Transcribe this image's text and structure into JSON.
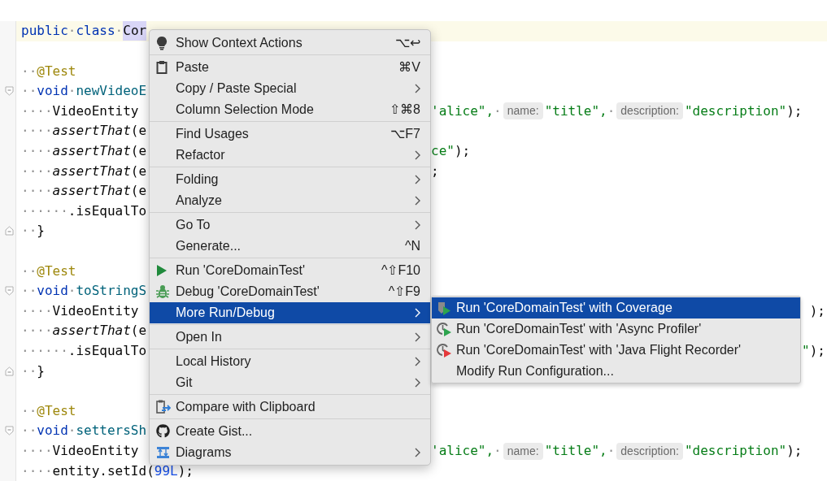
{
  "editor": {
    "lines": [
      {
        "current": true,
        "kind": "plain",
        "left": [
          {
            "kind": "keyword",
            "text": "public"
          },
          {
            "kind": "space",
            "text": "·"
          },
          {
            "kind": "keyword",
            "text": "class"
          },
          {
            "kind": "space",
            "text": "·"
          },
          {
            "kind": "selected",
            "text": "Cor"
          }
        ]
      },
      {
        "current": false,
        "kind": "plain"
      },
      {
        "current": false,
        "kind": "plain",
        "left": [
          {
            "kind": "space",
            "text": "··"
          },
          {
            "kind": "annotation",
            "text": "@Test"
          }
        ]
      },
      {
        "current": false,
        "kind": "foldstart",
        "left": [
          {
            "kind": "space",
            "text": "··"
          },
          {
            "kind": "keyword",
            "text": "void"
          },
          {
            "kind": "space",
            "text": "·"
          },
          {
            "kind": "method",
            "text": "newVideoE"
          }
        ]
      },
      {
        "current": false,
        "kind": "plain",
        "left": [
          {
            "kind": "space",
            "text": "····"
          },
          {
            "kind": "plain",
            "text": "VideoEntity"
          }
        ],
        "right": [
          {
            "kind": "string",
            "text": "'alice\","
          },
          {
            "kind": "space",
            "text": "·"
          },
          {
            "kind": "hint",
            "text": "name:"
          },
          {
            "kind": "string",
            "text": "\"title\","
          },
          {
            "kind": "space",
            "text": "·"
          },
          {
            "kind": "hint",
            "text": "description:"
          },
          {
            "kind": "string",
            "text": "\"description\""
          },
          {
            "kind": "plain",
            "text": ");"
          }
        ]
      },
      {
        "current": false,
        "kind": "plain",
        "left": [
          {
            "kind": "space",
            "text": "····"
          },
          {
            "kind": "italic",
            "text": "assertThat"
          },
          {
            "kind": "plain",
            "text": "(e"
          }
        ]
      },
      {
        "current": false,
        "kind": "plain",
        "left": [
          {
            "kind": "space",
            "text": "····"
          },
          {
            "kind": "italic",
            "text": "assertThat"
          },
          {
            "kind": "plain",
            "text": "(e"
          }
        ],
        "right": [
          {
            "kind": "string",
            "text": "ce\""
          },
          {
            "kind": "plain",
            "text": ");"
          }
        ]
      },
      {
        "current": false,
        "kind": "plain",
        "left": [
          {
            "kind": "space",
            "text": "····"
          },
          {
            "kind": "italic",
            "text": "assertThat"
          },
          {
            "kind": "plain",
            "text": "(e"
          }
        ],
        "right": [
          {
            "kind": "plain",
            "text": ";"
          }
        ]
      },
      {
        "current": false,
        "kind": "plain",
        "left": [
          {
            "kind": "space",
            "text": "····"
          },
          {
            "kind": "italic",
            "text": "assertThat"
          },
          {
            "kind": "plain",
            "text": "(e"
          }
        ]
      },
      {
        "current": false,
        "kind": "plain",
        "left": [
          {
            "kind": "space",
            "text": "······"
          },
          {
            "kind": "plain",
            "text": ".isEqualTo"
          }
        ]
      },
      {
        "current": false,
        "kind": "foldend",
        "left": [
          {
            "kind": "space",
            "text": "··"
          },
          {
            "kind": "plain",
            "text": "}"
          }
        ]
      },
      {
        "current": false,
        "kind": "plain"
      },
      {
        "current": false,
        "kind": "plain",
        "left": [
          {
            "kind": "space",
            "text": "··"
          },
          {
            "kind": "annotation",
            "text": "@Test"
          }
        ]
      },
      {
        "current": false,
        "kind": "foldstart",
        "left": [
          {
            "kind": "space",
            "text": "··"
          },
          {
            "kind": "keyword",
            "text": "void"
          },
          {
            "kind": "space",
            "text": "·"
          },
          {
            "kind": "method",
            "text": "toStringS"
          }
        ]
      },
      {
        "current": false,
        "kind": "trailing",
        "left": [
          {
            "kind": "space",
            "text": "····"
          },
          {
            "kind": "plain",
            "text": "VideoEntity"
          }
        ],
        "right": [
          {
            "kind": "plain",
            "text": ");"
          }
        ]
      },
      {
        "current": false,
        "kind": "plain",
        "left": [
          {
            "kind": "space",
            "text": "····"
          },
          {
            "kind": "italic",
            "text": "assertThat"
          },
          {
            "kind": "plain",
            "text": "(e"
          }
        ]
      },
      {
        "current": false,
        "kind": "trailing",
        "left": [
          {
            "kind": "space",
            "text": "······"
          },
          {
            "kind": "plain",
            "text": ".isEqualTo"
          }
        ],
        "right": [
          {
            "kind": "string",
            "text": "\""
          },
          {
            "kind": "plain",
            "text": ");"
          }
        ]
      },
      {
        "current": false,
        "kind": "foldend",
        "left": [
          {
            "kind": "space",
            "text": "··"
          },
          {
            "kind": "plain",
            "text": "}"
          }
        ]
      },
      {
        "current": false,
        "kind": "plain"
      },
      {
        "current": false,
        "kind": "plain",
        "left": [
          {
            "kind": "space",
            "text": "··"
          },
          {
            "kind": "annotation",
            "text": "@Test"
          }
        ]
      },
      {
        "current": false,
        "kind": "foldstart",
        "left": [
          {
            "kind": "space",
            "text": "··"
          },
          {
            "kind": "keyword",
            "text": "void"
          },
          {
            "kind": "space",
            "text": "·"
          },
          {
            "kind": "method",
            "text": "settersSh"
          }
        ]
      },
      {
        "current": false,
        "kind": "plain",
        "left": [
          {
            "kind": "space",
            "text": "····"
          },
          {
            "kind": "plain",
            "text": "VideoEntity"
          }
        ],
        "right": [
          {
            "kind": "string",
            "text": "'alice\","
          },
          {
            "kind": "space",
            "text": "·"
          },
          {
            "kind": "hint",
            "text": "name:"
          },
          {
            "kind": "string",
            "text": "\"title\","
          },
          {
            "kind": "space",
            "text": "·"
          },
          {
            "kind": "hint",
            "text": "description:"
          },
          {
            "kind": "string",
            "text": "\"description\""
          },
          {
            "kind": "plain",
            "text": ");"
          }
        ]
      },
      {
        "current": false,
        "kind": "plain",
        "left": [
          {
            "kind": "space",
            "text": "····"
          },
          {
            "kind": "plain",
            "text": "entity.setId("
          },
          {
            "kind": "number",
            "text": "99L"
          },
          {
            "kind": "plain",
            "text": ");"
          }
        ]
      }
    ]
  },
  "context_menu": {
    "groups": [
      {
        "items": [
          {
            "kind": "bulb",
            "label": "Show Context Actions",
            "shortcut": "⌥↩",
            "submenu": false,
            "selected": false
          }
        ]
      },
      {
        "items": [
          {
            "kind": "clipboard",
            "label": "Paste",
            "shortcut": "⌘V",
            "submenu": false,
            "selected": false
          },
          {
            "kind": "text",
            "label": "Copy / Paste Special",
            "submenu": true,
            "selected": false
          },
          {
            "kind": "text",
            "label": "Column Selection Mode",
            "shortcut": "⇧⌘8",
            "submenu": false,
            "selected": false
          }
        ]
      },
      {
        "items": [
          {
            "kind": "text",
            "label": "Find Usages",
            "shortcut": "⌥F7",
            "submenu": false,
            "selected": false
          },
          {
            "kind": "text",
            "label": "Refactor",
            "submenu": true,
            "selected": false
          }
        ]
      },
      {
        "items": [
          {
            "kind": "text",
            "label": "Folding",
            "submenu": true,
            "selected": false
          },
          {
            "kind": "text",
            "label": "Analyze",
            "submenu": true,
            "selected": false
          }
        ]
      },
      {
        "items": [
          {
            "kind": "text",
            "label": "Go To",
            "submenu": true,
            "selected": false
          },
          {
            "kind": "text",
            "label": "Generate...",
            "shortcut": "^N",
            "submenu": false,
            "selected": false
          }
        ]
      },
      {
        "items": [
          {
            "kind": "run",
            "label": "Run 'CoreDomainTest'",
            "shortcut": "^⇧F10",
            "submenu": false,
            "selected": false
          },
          {
            "kind": "debug",
            "label": "Debug 'CoreDomainTest'",
            "shortcut": "^⇧F9",
            "submenu": false,
            "selected": false
          },
          {
            "kind": "text",
            "label": "More Run/Debug",
            "submenu": true,
            "selected": true
          }
        ]
      },
      {
        "items": [
          {
            "kind": "text",
            "label": "Open In",
            "submenu": true,
            "selected": false
          }
        ]
      },
      {
        "items": [
          {
            "kind": "text",
            "label": "Local History",
            "submenu": true,
            "selected": false
          },
          {
            "kind": "text",
            "label": "Git",
            "submenu": true,
            "selected": false
          }
        ]
      },
      {
        "items": [
          {
            "kind": "compare",
            "label": "Compare with Clipboard",
            "submenu": false,
            "selected": false
          }
        ]
      },
      {
        "items": [
          {
            "kind": "gist",
            "label": "Create Gist...",
            "submenu": false,
            "selected": false
          },
          {
            "kind": "diagram",
            "label": "Diagrams",
            "submenu": true,
            "selected": false
          }
        ]
      }
    ]
  },
  "submenu": {
    "items": [
      {
        "kind": "coverage",
        "label": "Run 'CoreDomainTest' with Coverage",
        "selected": true
      },
      {
        "kind": "profiler",
        "label": "Run 'CoreDomainTest' with 'Async Profiler'",
        "selected": false
      },
      {
        "kind": "recorder",
        "label": "Run 'CoreDomainTest' with 'Java Flight Recorder'",
        "selected": false
      },
      {
        "kind": "text",
        "label": "Modify Run Configuration...",
        "selected": false
      }
    ]
  }
}
